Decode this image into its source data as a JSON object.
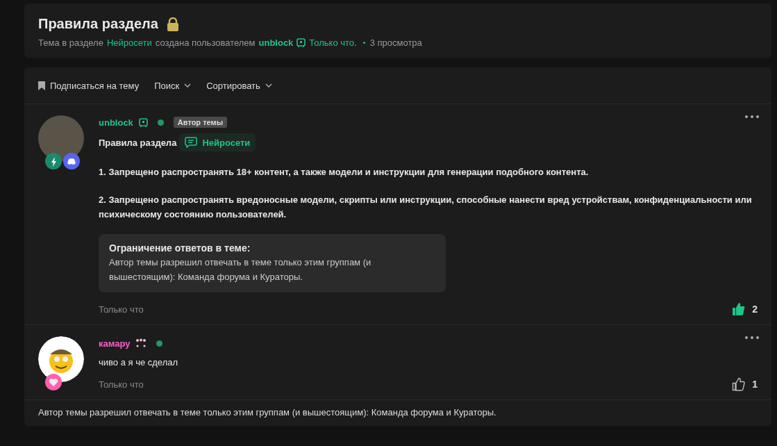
{
  "header": {
    "title": "Правила раздела",
    "meta_prefix": "Тема в разделе",
    "section": "Нейросети",
    "meta_mid": "создана пользователем",
    "author": "unblock",
    "time": "Только что.",
    "views": "3 просмотра"
  },
  "toolbar": [
    {
      "kind": "bookmark",
      "label": "Подписаться на тему"
    },
    {
      "kind": "dropdown",
      "label": "Поиск"
    },
    {
      "kind": "dropdown",
      "label": "Сортировать"
    }
  ],
  "posts": [
    {
      "kind": "topic",
      "username": "unblock",
      "color": "#1fc487",
      "online": true,
      "author_badge": "Автор темы",
      "badges": [
        {
          "kind": "bolt",
          "color": "#1a8a6a"
        },
        {
          "kind": "discord",
          "color": "#5865f2"
        }
      ],
      "title": "Правила раздела",
      "tag": "Нейросети",
      "paragraphs": [
        "1. Запрещено распространять 18+ контент, а также модели и инструкции для генерации подобного контента.",
        "2. Запрещено распространять вредоносные модели, скрипты или инструкции, способные нанести вред устройствам, конфиденциальности или психическому состоянию пользователей."
      ],
      "notice": {
        "title": "Ограничение ответов в теме:",
        "text": "Автор темы разрешил отвечать в теме только этим группам (и вышестоящим): Команда форума и Кураторы."
      },
      "time": "Только что",
      "liked": true,
      "likes": "2"
    },
    {
      "kind": "reply",
      "username": "камару",
      "color": "#ff5fc8",
      "online": true,
      "badges": [
        {
          "kind": "heart",
          "color": "#ff5fb0"
        }
      ],
      "body": "чиво а я че сделал",
      "time": "Только что",
      "liked": false,
      "likes": "1"
    }
  ],
  "footer_note": "Автор темы разрешил отвечать в теме только этим группам (и вышестоящим): Команда форума и Кураторы."
}
